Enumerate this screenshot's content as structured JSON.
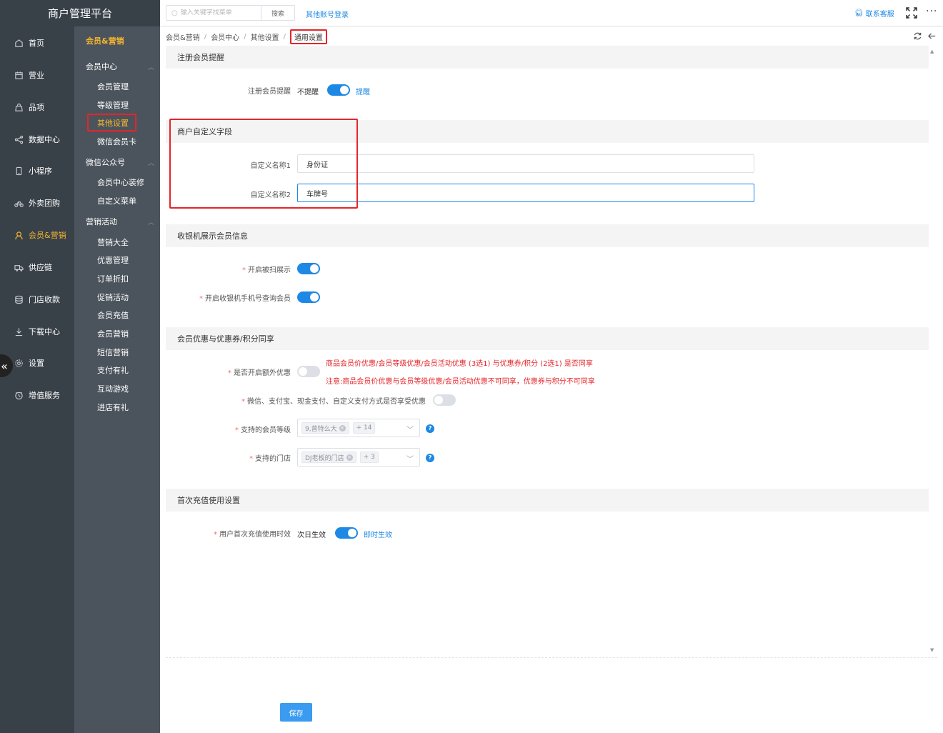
{
  "app": {
    "title": "商户管理平台"
  },
  "sidebar": {
    "items": [
      {
        "label": "首页",
        "icon": "home-icon"
      },
      {
        "label": "营业",
        "icon": "calendar-icon"
      },
      {
        "label": "品项",
        "icon": "bag-icon"
      },
      {
        "label": "数据中心",
        "icon": "share-icon"
      },
      {
        "label": "小程序",
        "icon": "phone-icon"
      },
      {
        "label": "外卖团购",
        "icon": "bike-icon"
      },
      {
        "label": "会员&营销",
        "icon": "user-icon",
        "active": true
      },
      {
        "label": "供应链",
        "icon": "truck-icon"
      },
      {
        "label": "门店收款",
        "icon": "coins-icon"
      },
      {
        "label": "下载中心",
        "icon": "download-icon"
      },
      {
        "label": "设置",
        "icon": "gear-icon"
      },
      {
        "label": "增值服务",
        "icon": "clock-icon"
      }
    ]
  },
  "subnav": {
    "title": "会员&营销",
    "groups": [
      {
        "label": "会员中心",
        "items": [
          "会员管理",
          "等级管理",
          "其他设置",
          "微信会员卡"
        ]
      },
      {
        "label": "微信公众号",
        "items": [
          "会员中心装修",
          "自定义菜单"
        ]
      },
      {
        "label": "营销活动",
        "items": [
          "营销大全",
          "优惠管理",
          "订单折扣",
          "促销活动",
          "会员充值",
          "会员营销",
          "短信营销",
          "支付有礼",
          "互动游戏",
          "进店有礼"
        ]
      }
    ],
    "active_item": "其他设置"
  },
  "topbar": {
    "search_placeholder": "输入关键字找菜单",
    "search_button": "搜索",
    "other_login": "其他账号登录",
    "contact": "联系客服",
    "more": "···"
  },
  "breadcrumb": [
    "会员&营销",
    "会员中心",
    "其他设置",
    "通用设置"
  ],
  "sections": {
    "register": {
      "title": "注册会员提醒",
      "label": "注册会员提醒",
      "off_text": "不提醒",
      "on_text": "提醒",
      "enabled": true
    },
    "custom_fields": {
      "title": "商户自定义字段",
      "field1_label": "自定义名称1",
      "field1_value": "身份证",
      "field2_label": "自定义名称2",
      "field2_value": "车牌号"
    },
    "cashier": {
      "title": "收银机展示会员信息",
      "scan_label": "开启被扫展示",
      "scan_enabled": true,
      "phone_label": "开启收银机手机号查询会员",
      "phone_enabled": true
    },
    "sharing": {
      "title": "会员优惠与优惠券/积分同享",
      "extra_label": "是否开启额外优惠",
      "extra_enabled": false,
      "extra_note1": "商品会员价优惠/会员等级优惠/会员活动优惠 (3选1) 与优惠券/积分 (2选1) 是否同享",
      "extra_note2": "注意:商品会员价优惠与会员等级优惠/会员活动优惠不可同享，优惠券与积分不可同享",
      "payment_label": "微信、支付宝、现金支付、自定义支付方式是否享受优惠",
      "payment_enabled": false,
      "levels_label": "支持的会员等级",
      "levels_tag": "9,曾特么大",
      "levels_more": "+ 14",
      "stores_label": "支持的门店",
      "stores_tag": "DJ老板的门店",
      "stores_more": "+ 3"
    },
    "recharge": {
      "title": "首次充值使用设置",
      "label": "用户首次充值使用时效",
      "off_text": "次日生效",
      "on_text": "即时生效",
      "enabled": true
    }
  },
  "footer": {
    "save_label": "保存"
  },
  "colors": {
    "accent": "#1e88e5",
    "active_nav": "#f5b52f",
    "warning": "#e5252a",
    "sidebar": "#394148",
    "subnav": "#4b545c"
  }
}
